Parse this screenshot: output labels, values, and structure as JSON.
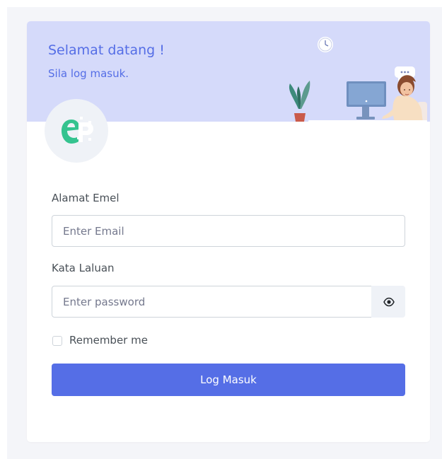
{
  "banner": {
    "title": "Selamat datang !",
    "subtitle": "Sila log masuk.",
    "illustration_icon": "woman-at-desk-illustration"
  },
  "logo": {
    "icon": "ep-logo-icon"
  },
  "form": {
    "email_label": "Alamat Emel",
    "email_placeholder": "Enter Email",
    "email_value": "",
    "password_label": "Kata Laluan",
    "password_placeholder": "Enter password",
    "password_value": "",
    "show_password_icon": "eye-icon",
    "remember_label": "Remember me",
    "remember_checked": false,
    "submit_label": "Log Masuk"
  },
  "colors": {
    "accent": "#556ee6",
    "banner_bg": "#d5dafa",
    "page_bg": "#f4f5f9",
    "logo_green": "#34c38f"
  }
}
